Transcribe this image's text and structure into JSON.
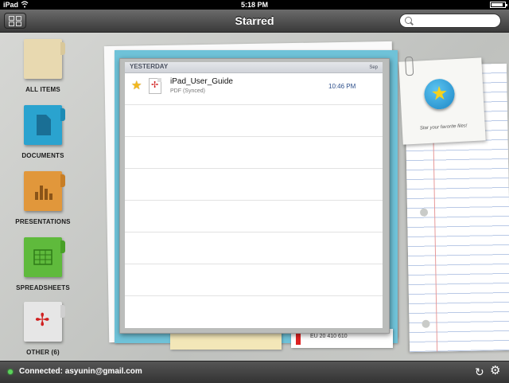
{
  "statusbar": {
    "carrier": "iPad",
    "time": "5:18 PM"
  },
  "navbar": {
    "title": "Starred",
    "search_placeholder": ""
  },
  "sidebar": {
    "items": [
      {
        "label": "ALL ITEMS",
        "color": "#e8d9b0"
      },
      {
        "label": "DOCUMENTS",
        "color": "#2aa3cf"
      },
      {
        "label": "PRESENTATIONS",
        "color": "#e1973b"
      },
      {
        "label": "SPREADSHEETS",
        "color": "#5fba3c"
      },
      {
        "label": "OTHER (6)",
        "color": "#e6e6e6"
      }
    ]
  },
  "note": {
    "text": "Star your favorite files!"
  },
  "list": {
    "section_header": "YESTERDAY",
    "column_hint": "Sep",
    "files": [
      {
        "name": "iPad_User_Guide",
        "subtitle": "PDF (Synced)",
        "time": "10:46 PM"
      }
    ]
  },
  "background_marks": {
    "barcode_text": "EU 20 410 610"
  },
  "bottombar": {
    "status": "Connected: asyunin@gmail.com"
  }
}
